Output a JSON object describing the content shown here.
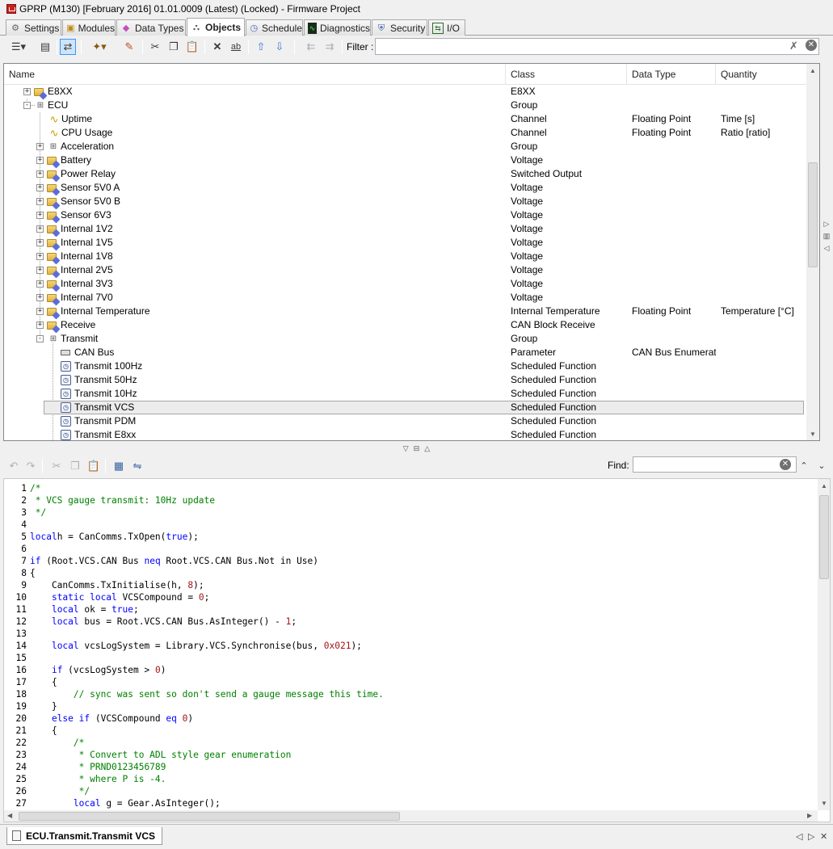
{
  "window": {
    "title": "GPRP (M130) [February 2016] 01.01.0009 (Latest) (Locked) - Firmware Project"
  },
  "tabs": [
    {
      "label": "Settings",
      "icon": "settings-icon"
    },
    {
      "label": "Modules",
      "icon": "modules-icon"
    },
    {
      "label": "Data Types",
      "icon": "data-types-icon"
    },
    {
      "label": "Objects",
      "icon": "objects-icon",
      "active": true
    },
    {
      "label": "Schedule",
      "icon": "schedule-icon"
    },
    {
      "label": "Diagnostics",
      "icon": "diagnostics-icon"
    },
    {
      "label": "Security",
      "icon": "security-icon"
    },
    {
      "label": "I/O",
      "icon": "io-icon"
    }
  ],
  "toolbar": {
    "filter_label": "Filter :",
    "filter_value": ""
  },
  "tree": {
    "columns": [
      "Name",
      "Class",
      "Data Type",
      "Quantity"
    ],
    "rows": [
      {
        "name": "E8XX",
        "class": "E8XX",
        "type": "",
        "qty": "",
        "level": 1,
        "exp": "+",
        "icon": "folder"
      },
      {
        "name": "ECU",
        "class": "Group",
        "type": "",
        "qty": "",
        "level": 1,
        "exp": "-",
        "icon": "group"
      },
      {
        "name": "Uptime",
        "class": "Channel",
        "type": "Floating Point",
        "qty": "Time [s]",
        "level": 2,
        "exp": "",
        "icon": "channel"
      },
      {
        "name": "CPU Usage",
        "class": "Channel",
        "type": "Floating Point",
        "qty": "Ratio [ratio]",
        "level": 2,
        "exp": "",
        "icon": "channel"
      },
      {
        "name": "Acceleration",
        "class": "Group",
        "type": "",
        "qty": "",
        "level": 2,
        "exp": "+",
        "icon": "group"
      },
      {
        "name": "Battery",
        "class": "Voltage",
        "type": "",
        "qty": "",
        "level": 2,
        "exp": "+",
        "icon": "folder"
      },
      {
        "name": "Power Relay",
        "class": "Switched Output",
        "type": "",
        "qty": "",
        "level": 2,
        "exp": "+",
        "icon": "folder"
      },
      {
        "name": "Sensor 5V0 A",
        "class": "Voltage",
        "type": "",
        "qty": "",
        "level": 2,
        "exp": "+",
        "icon": "folder"
      },
      {
        "name": "Sensor 5V0 B",
        "class": "Voltage",
        "type": "",
        "qty": "",
        "level": 2,
        "exp": "+",
        "icon": "folder"
      },
      {
        "name": "Sensor 6V3",
        "class": "Voltage",
        "type": "",
        "qty": "",
        "level": 2,
        "exp": "+",
        "icon": "folder"
      },
      {
        "name": "Internal 1V2",
        "class": "Voltage",
        "type": "",
        "qty": "",
        "level": 2,
        "exp": "+",
        "icon": "folder"
      },
      {
        "name": "Internal 1V5",
        "class": "Voltage",
        "type": "",
        "qty": "",
        "level": 2,
        "exp": "+",
        "icon": "folder"
      },
      {
        "name": "Internal 1V8",
        "class": "Voltage",
        "type": "",
        "qty": "",
        "level": 2,
        "exp": "+",
        "icon": "folder"
      },
      {
        "name": "Internal 2V5",
        "class": "Voltage",
        "type": "",
        "qty": "",
        "level": 2,
        "exp": "+",
        "icon": "folder"
      },
      {
        "name": "Internal 3V3",
        "class": "Voltage",
        "type": "",
        "qty": "",
        "level": 2,
        "exp": "+",
        "icon": "folder"
      },
      {
        "name": "Internal 7V0",
        "class": "Voltage",
        "type": "",
        "qty": "",
        "level": 2,
        "exp": "+",
        "icon": "folder"
      },
      {
        "name": "Internal Temperature",
        "class": "Internal Temperature",
        "type": "Floating Point",
        "qty": "Temperature [°C]",
        "level": 2,
        "exp": "+",
        "icon": "folder"
      },
      {
        "name": "Receive",
        "class": "CAN Block Receive",
        "type": "",
        "qty": "",
        "level": 2,
        "exp": "+",
        "icon": "folder"
      },
      {
        "name": "Transmit",
        "class": "Group",
        "type": "",
        "qty": "",
        "level": 2,
        "exp": "-",
        "icon": "group"
      },
      {
        "name": "CAN Bus",
        "class": "Parameter",
        "type": "CAN Bus Enumerati...",
        "qty": "",
        "level": 3,
        "exp": "",
        "icon": "param"
      },
      {
        "name": "Transmit 100Hz",
        "class": "Scheduled Function",
        "type": "",
        "qty": "",
        "level": 3,
        "exp": "",
        "icon": "sched"
      },
      {
        "name": "Transmit 50Hz",
        "class": "Scheduled Function",
        "type": "",
        "qty": "",
        "level": 3,
        "exp": "",
        "icon": "sched"
      },
      {
        "name": "Transmit 10Hz",
        "class": "Scheduled Function",
        "type": "",
        "qty": "",
        "level": 3,
        "exp": "",
        "icon": "sched"
      },
      {
        "name": "Transmit VCS",
        "class": "Scheduled Function",
        "type": "",
        "qty": "",
        "level": 3,
        "exp": "",
        "icon": "sched",
        "selected": true
      },
      {
        "name": "Transmit PDM",
        "class": "Scheduled Function",
        "type": "",
        "qty": "",
        "level": 3,
        "exp": "",
        "icon": "sched"
      },
      {
        "name": "Transmit E8xx",
        "class": "Scheduled Function",
        "type": "",
        "qty": "",
        "level": 3,
        "exp": "",
        "icon": "sched"
      }
    ]
  },
  "editor": {
    "find_label": "Find:",
    "find_value": "",
    "lines": [
      [
        [
          "cm",
          "/*"
        ]
      ],
      [
        [
          "cm",
          " * VCS gauge transmit: 10Hz update"
        ]
      ],
      [
        [
          "cm",
          " */"
        ]
      ],
      [],
      [
        [
          "kw",
          "local"
        ],
        [
          "",
          "h = CanComms.TxOpen("
        ],
        [
          "kw",
          "true"
        ],
        [
          "",
          ");"
        ]
      ],
      [],
      [
        [
          "kw",
          "if"
        ],
        [
          "",
          " (Root.VCS.CAN Bus "
        ],
        [
          "kw",
          "neq"
        ],
        [
          "",
          " Root.VCS.CAN Bus.Not in Use)"
        ]
      ],
      [
        [
          "",
          "{"
        ]
      ],
      [
        [
          "",
          "    CanComms.TxInitialise(h, "
        ],
        [
          "num",
          "8"
        ],
        [
          "",
          ");"
        ]
      ],
      [
        [
          "",
          "    "
        ],
        [
          "kw",
          "static local"
        ],
        [
          "",
          " VCSCompound = "
        ],
        [
          "num",
          "0"
        ],
        [
          "",
          ";"
        ]
      ],
      [
        [
          "",
          "    "
        ],
        [
          "kw",
          "local"
        ],
        [
          "",
          " ok = "
        ],
        [
          "kw",
          "true"
        ],
        [
          "",
          ";"
        ]
      ],
      [
        [
          "",
          "    "
        ],
        [
          "kw",
          "local"
        ],
        [
          "",
          " bus = Root.VCS.CAN Bus.AsInteger() - "
        ],
        [
          "num",
          "1"
        ],
        [
          "",
          ";"
        ]
      ],
      [],
      [
        [
          "",
          "    "
        ],
        [
          "kw",
          "local"
        ],
        [
          "",
          " vcsLogSystem = Library.VCS.Synchronise(bus, "
        ],
        [
          "num",
          "0x021"
        ],
        [
          "",
          ");"
        ]
      ],
      [],
      [
        [
          "",
          "    "
        ],
        [
          "kw",
          "if"
        ],
        [
          "",
          " (vcsLogSystem > "
        ],
        [
          "num",
          "0"
        ],
        [
          "",
          ")"
        ]
      ],
      [
        [
          "",
          "    {"
        ]
      ],
      [
        [
          "",
          "        "
        ],
        [
          "cm",
          "// sync was sent so don't send a gauge message this time."
        ]
      ],
      [
        [
          "",
          "    }"
        ]
      ],
      [
        [
          "",
          "    "
        ],
        [
          "kw",
          "else if"
        ],
        [
          "",
          " (VCSCompound "
        ],
        [
          "kw",
          "eq"
        ],
        [
          "",
          " "
        ],
        [
          "num",
          "0"
        ],
        [
          "",
          ")"
        ]
      ],
      [
        [
          "",
          "    {"
        ]
      ],
      [
        [
          "",
          "        "
        ],
        [
          "cm",
          "/*"
        ]
      ],
      [
        [
          "",
          "        "
        ],
        [
          "cm",
          " * Convert to ADL style gear enumeration"
        ]
      ],
      [
        [
          "",
          "        "
        ],
        [
          "cm",
          " * PRND0123456789"
        ]
      ],
      [
        [
          "",
          "        "
        ],
        [
          "cm",
          " * where P is -4."
        ]
      ],
      [
        [
          "",
          "        "
        ],
        [
          "cm",
          " */"
        ]
      ],
      [
        [
          "",
          "        "
        ],
        [
          "kw",
          "local"
        ],
        [
          "",
          " g = Gear.AsInteger();"
        ]
      ]
    ]
  },
  "document_tab": {
    "label": "ECU.Transmit.Transmit VCS"
  }
}
